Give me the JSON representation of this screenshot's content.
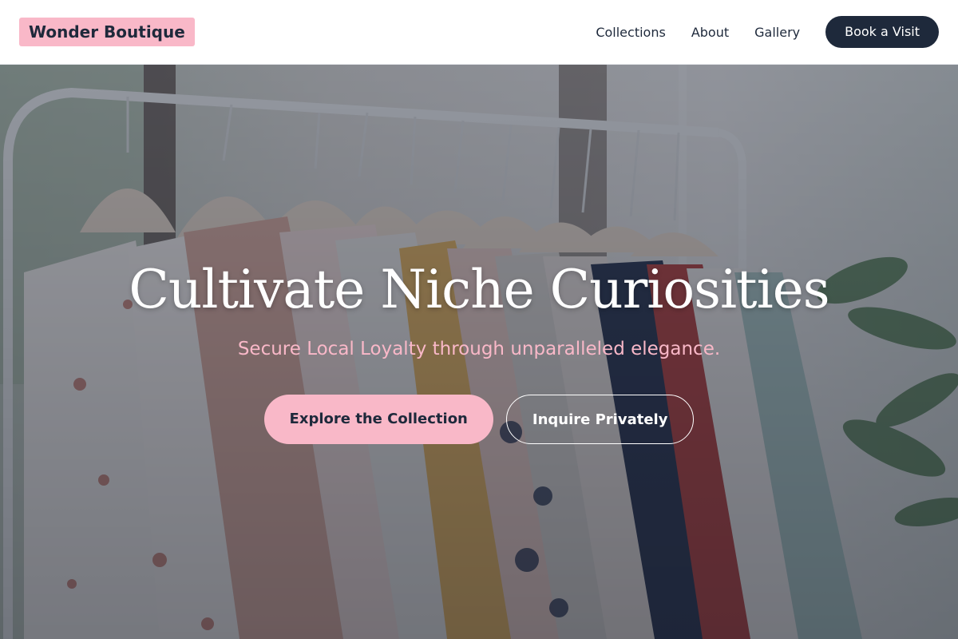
{
  "header": {
    "brand": "Wonder Boutique",
    "nav": [
      {
        "label": "Collections"
      },
      {
        "label": "About"
      },
      {
        "label": "Gallery"
      }
    ],
    "cta_label": "Book a Visit"
  },
  "hero": {
    "background_image": "clothing-rack-photo",
    "title": "Cultivate Niche Curiosities",
    "subtitle": "Secure Local Loyalty through unparalleled elegance.",
    "primary_button": "Explore the Collection",
    "secondary_button": "Inquire Privately"
  },
  "colors": {
    "accent_pink": "#f9b8c8",
    "navy": "#1e293b",
    "white": "#ffffff"
  }
}
